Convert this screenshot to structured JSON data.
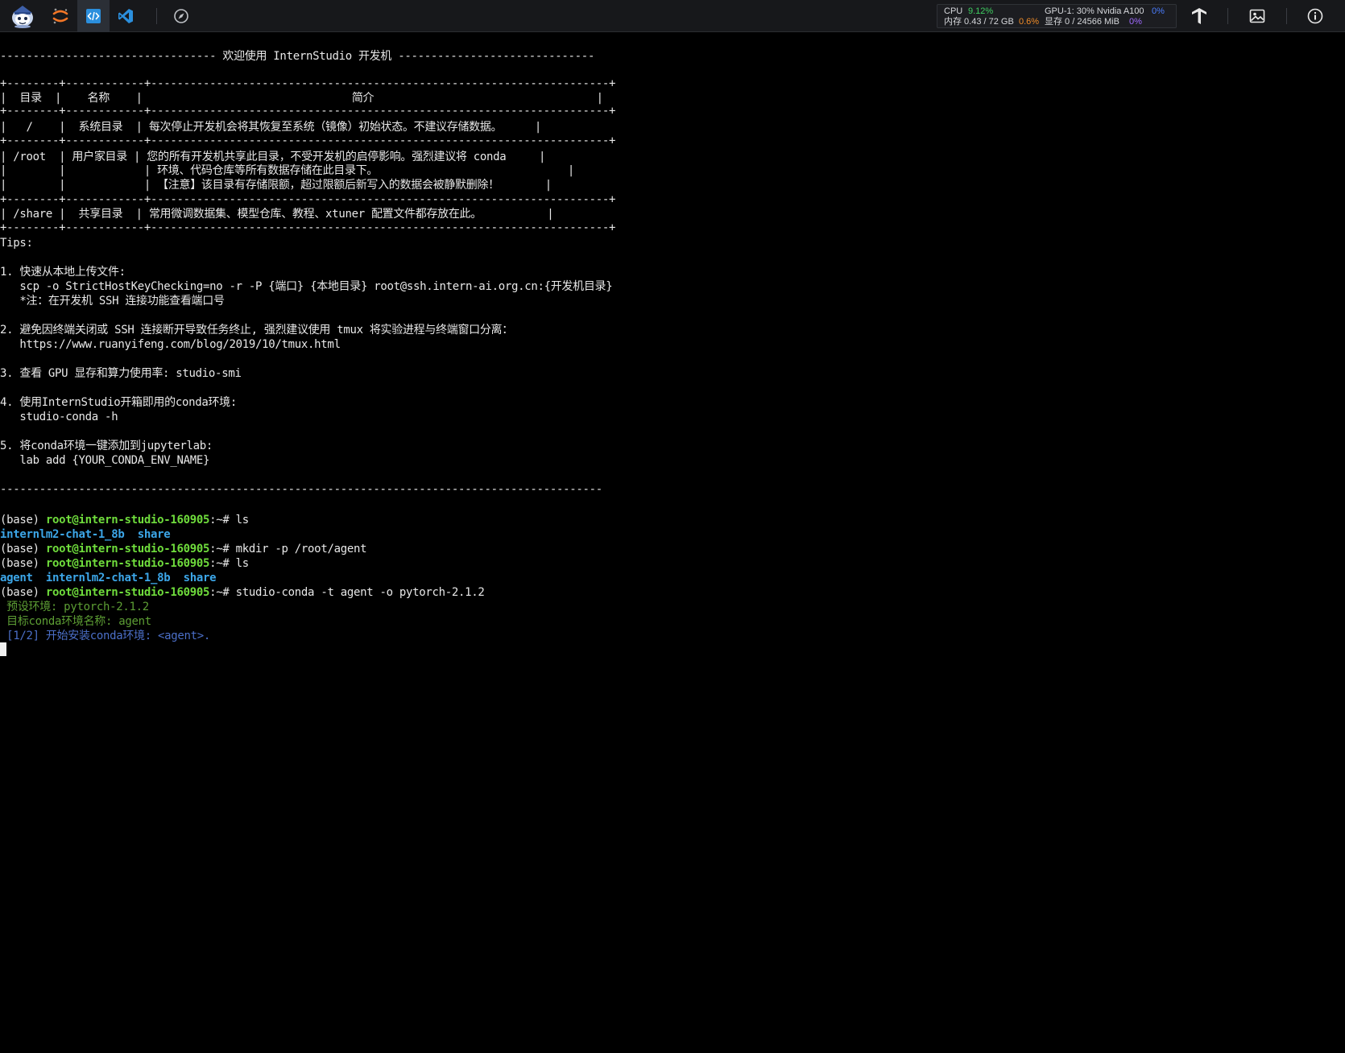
{
  "toolbar": {
    "icons": [
      "mascot-logo",
      "jupyter-icon",
      "code-editor-icon",
      "vscode-icon",
      "compass-icon"
    ],
    "right_icons": [
      "tensorboard-icon",
      "image-icon",
      "info-icon"
    ],
    "colors": {
      "jupyter": "#f37626",
      "code_editor": "#2b8fdd",
      "vscode": "#2b8fdd"
    }
  },
  "stats": {
    "cpu_label": "CPU",
    "cpu_value": "9.12%",
    "gpu_label": "GPU-1: 30% Nvidia A100",
    "gpu_value": "0%",
    "mem_label": "内存 0.43 / 72 GB",
    "mem_value": "0.6%",
    "vram_label": "显存 0 / 24566 MiB",
    "vram_value": "0%",
    "colors": {
      "cpu_value": "#3fcf61",
      "gpu_value": "#4a7dff",
      "mem_value": "#f08c28",
      "vram_value": "#a06bff"
    }
  },
  "terminal": {
    "banner": "--------------------------------- 欢迎使用 InternStudio 开发机 ------------------------------",
    "table_border": "+--------+------------+----------------------------------------------------------------------+",
    "table_header": "|  目录  |    名称    |                                简介                                  |",
    "row_system": "|   /    |  系统目录  | 每次停止开发机会将其恢复至系统（镜像）初始状态。不建议存储数据。     |",
    "row_root_1": "| /root  | 用户家目录 | 您的所有开发机共享此目录，不受开发机的启停影响。强烈建议将 conda     |",
    "row_root_2": "|        |            | 环境、代码仓库等所有数据存储在此目录下。                             |",
    "row_root_3": "|        |            | 【注意】该目录有存储限额，超过限额后新写入的数据会被静默删除！       |",
    "row_share": "| /share |  共享目录  | 常用微调数据集、模型仓库、教程、xtuner 配置文件都存放在此。          |",
    "tips_title": "Tips:",
    "tip1_title": "1. 快速从本地上传文件:",
    "tip1_cmd": "   scp -o StrictHostKeyChecking=no -r -P {端口} {本地目录} root@ssh.intern-ai.org.cn:{开发机目录}",
    "tip1_note": "   *注：在开发机 SSH 连接功能查看端口号",
    "tip2_title": "2. 避免因终端关闭或 SSH 连接断开导致任务终止, 强烈建议使用 tmux 将实验进程与终端窗口分离：",
    "tip2_url": "   https://www.ruanyifeng.com/blog/2019/10/tmux.html",
    "tip3": "3. 查看 GPU 显存和算力使用率: studio-smi",
    "tip4_title": "4. 使用InternStudio开箱即用的conda环境:",
    "tip4_cmd": "   studio-conda -h",
    "tip5_title": "5. 将conda环境一键添加到jupyterlab:",
    "tip5_cmd": "   lab add {YOUR_CONDA_ENV_NAME}",
    "footer_rule": "--------------------------------------------------------------------------------------------",
    "prompt_env": "(base) ",
    "prompt_user": "root@intern-studio-160905",
    "prompt_path": ":~# ",
    "cmd_ls": "ls",
    "ls_output_1": "internlm2-chat-1_8b  share",
    "cmd_mkdir": "mkdir -p /root/agent",
    "ls_output_2": "agent  internlm2-chat-1_8b  share",
    "cmd_conda": "studio-conda -t agent -o pytorch-2.1.2",
    "out_preset": " 预设环境: pytorch-2.1.2",
    "out_target": " 目标conda环境名称: agent",
    "out_install": " [1/2] 开始安装conda环境: <agent>."
  }
}
